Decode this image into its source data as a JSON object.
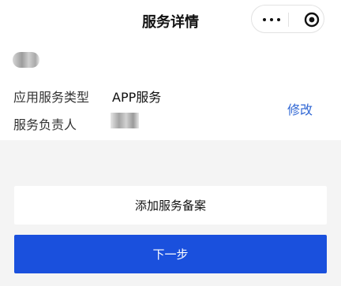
{
  "header": {
    "title": "服务详情",
    "more_icon": "more-dots-icon",
    "close_icon": "target-close-icon"
  },
  "detail": {
    "service_type_label": "应用服务类型",
    "service_type_value": "APP服务",
    "owner_label": "服务负责人",
    "modify_label": "修改"
  },
  "actions": {
    "add_filing_label": "添加服务备案",
    "next_label": "下一步"
  },
  "colors": {
    "accent": "#1a50dd",
    "link": "#2f66d4",
    "background": "#f4f4f4"
  }
}
